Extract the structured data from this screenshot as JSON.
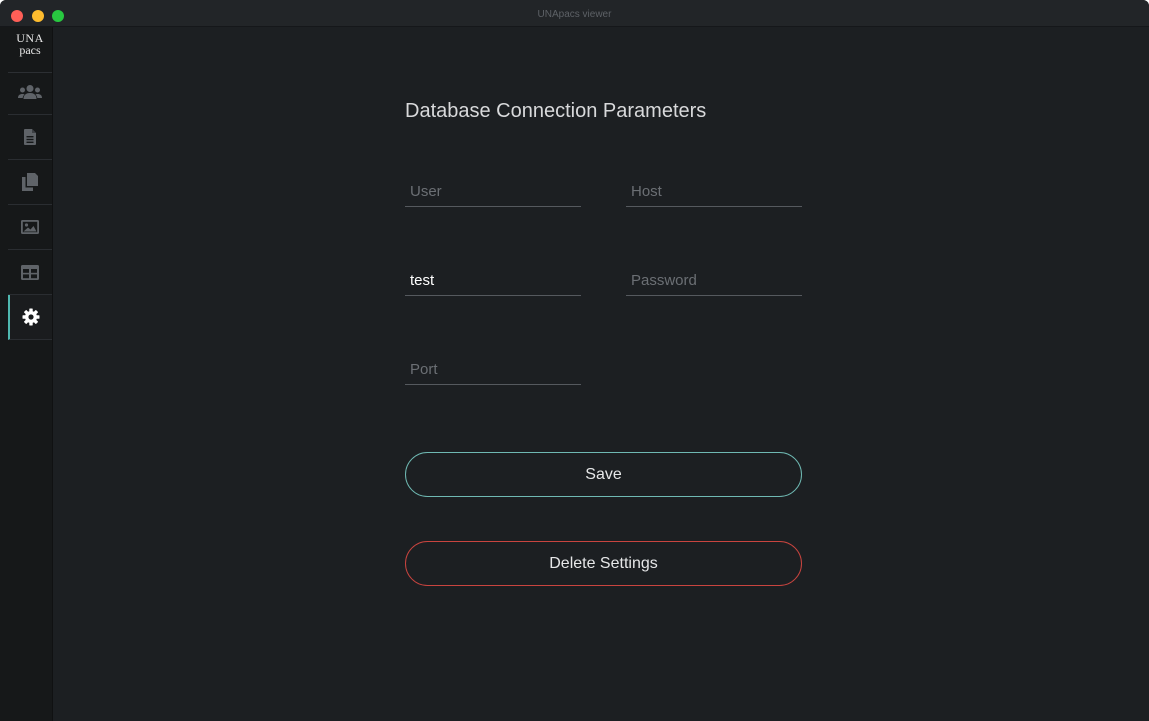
{
  "window": {
    "title": "UNApacs viewer"
  },
  "logo": {
    "line1": "UNA",
    "line2": "pacs"
  },
  "sidebar": {
    "items": [
      {
        "icon": "users-icon"
      },
      {
        "icon": "document-icon"
      },
      {
        "icon": "documents-copy-icon"
      },
      {
        "icon": "image-icon"
      },
      {
        "icon": "table-icon"
      },
      {
        "icon": "gear-icon",
        "active": true
      }
    ],
    "active_accent": "#4fb8b0"
  },
  "form": {
    "title": "Database Connection Parameters",
    "user": {
      "value": "",
      "placeholder": "User"
    },
    "host": {
      "value": "",
      "placeholder": "Host"
    },
    "database": {
      "value": "test",
      "placeholder": ""
    },
    "password": {
      "value": "",
      "placeholder": "Password"
    },
    "port": {
      "value": "",
      "placeholder": "Port"
    },
    "save_label": "Save",
    "delete_label": "Delete Settings"
  },
  "colors": {
    "save_border": "#6fb9b3",
    "delete_border": "#c9443f",
    "background": "#1c1f22"
  }
}
